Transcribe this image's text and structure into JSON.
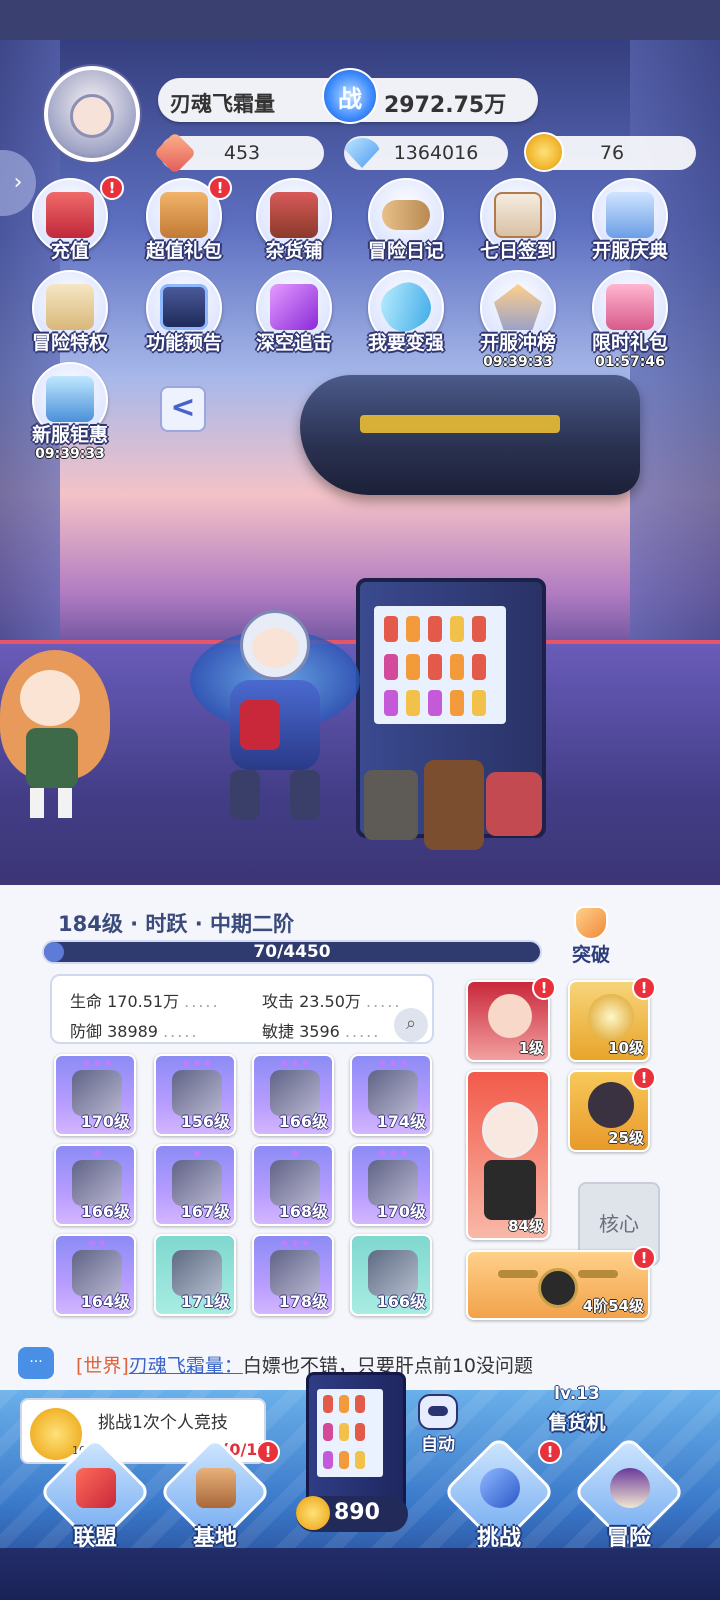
{
  "player": {
    "name": "刃魂飞霜量",
    "power_icon": "战",
    "power": "2972.75万"
  },
  "resources": [
    {
      "icon": "crystal-icon",
      "value": "453"
    },
    {
      "icon": "diamond-icon",
      "value": "1364016"
    },
    {
      "icon": "coin-icon",
      "value": "76"
    }
  ],
  "menu": [
    {
      "label": "充值",
      "badge": "!",
      "timer": ""
    },
    {
      "label": "超值礼包",
      "badge": "!",
      "timer": ""
    },
    {
      "label": "杂货铺",
      "badge": "",
      "timer": ""
    },
    {
      "label": "冒险日记",
      "badge": "",
      "timer": ""
    },
    {
      "label": "七日签到",
      "badge": "",
      "timer": ""
    },
    {
      "label": "开服庆典",
      "badge": "",
      "timer": ""
    },
    {
      "label": "冒险特权",
      "badge": "",
      "timer": ""
    },
    {
      "label": "功能预告",
      "badge": "",
      "timer": ""
    },
    {
      "label": "深空追击",
      "badge": "",
      "timer": ""
    },
    {
      "label": "我要变强",
      "badge": "",
      "timer": ""
    },
    {
      "label": "开服冲榜",
      "badge": "",
      "timer": "09:39:33"
    },
    {
      "label": "限时礼包",
      "badge": "",
      "timer": "01:57:46"
    },
    {
      "label": "新服钜惠",
      "badge": "",
      "timer": "09:39:33"
    }
  ],
  "back_label": "<",
  "character": {
    "level_text": "184级 · 时跃 · 中期二阶",
    "breakthrough": "突破",
    "xp": "70/4450",
    "xp_fraction": 0.016,
    "stats": {
      "hp": "生命 170.51万",
      "atk": "攻击 23.50万",
      "def": "防御 38989",
      "agi": "敏捷 3596",
      "dots": "....."
    }
  },
  "equipment": [
    {
      "level": "170级",
      "stars": "★★★",
      "rarity": "purple"
    },
    {
      "level": "156级",
      "stars": "★★★",
      "rarity": "purple"
    },
    {
      "level": "166级",
      "stars": "★★★",
      "rarity": "purple"
    },
    {
      "level": "174级",
      "stars": "★★★",
      "rarity": "purple"
    },
    {
      "level": "166级",
      "stars": "★",
      "rarity": "purple"
    },
    {
      "level": "167级",
      "stars": "★",
      "rarity": "purple"
    },
    {
      "level": "168级",
      "stars": "★",
      "rarity": "purple"
    },
    {
      "level": "170级",
      "stars": "★★★",
      "rarity": "purple"
    },
    {
      "level": "164级",
      "stars": "★★",
      "rarity": "purple"
    },
    {
      "level": "171级",
      "stars": "",
      "rarity": "teal"
    },
    {
      "level": "178级",
      "stars": "★★★",
      "rarity": "purple"
    },
    {
      "level": "166级",
      "stars": "",
      "rarity": "teal"
    }
  ],
  "side_cards": [
    {
      "level": "1级"
    },
    {
      "level": "10级"
    },
    {
      "level": "84级"
    },
    {
      "level": "25级"
    },
    {
      "level": "4阶54级"
    }
  ],
  "core_label": "核心",
  "chat": {
    "channel": "[世界]",
    "sender": "刃魂飞霜量：",
    "message": "白嫖也不错，只要肝点前10没问题"
  },
  "task": {
    "coin_count": "10",
    "title": "挑战1次个人竞技",
    "progress": "(0/1)"
  },
  "vending": {
    "coins": "890",
    "auto": "自动",
    "shop_level": "lv.13",
    "shop_label": "售货机"
  },
  "nav": [
    {
      "label": "联盟",
      "badge": ""
    },
    {
      "label": "基地",
      "badge": "!"
    },
    {
      "label": "挑战",
      "badge": "!"
    },
    {
      "label": "冒险",
      "badge": ""
    }
  ],
  "colors": {
    "accent": "#3b64c8",
    "alert": "#e8313b",
    "equip_purple": "#b69cff",
    "equip_teal": "#a8ece2"
  }
}
